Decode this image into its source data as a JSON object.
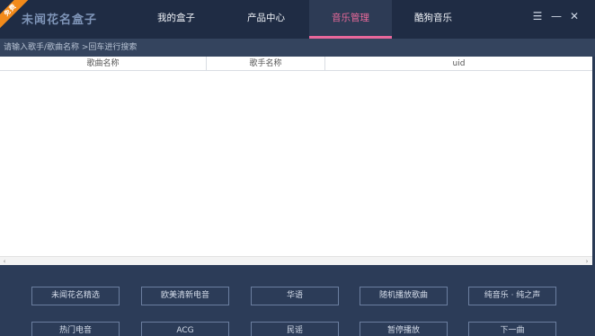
{
  "app": {
    "ribbon": "免费",
    "title": "未闻花名盒子"
  },
  "nav": {
    "tabs": [
      {
        "label": "我的盒子",
        "active": false
      },
      {
        "label": "产品中心",
        "active": false
      },
      {
        "label": "音乐管理",
        "active": true
      },
      {
        "label": "酷狗音乐",
        "active": false
      }
    ]
  },
  "window_controls": {
    "menu": "☰",
    "minimize": "—",
    "close": "✕"
  },
  "search": {
    "placeholder": "请输入歌手/歌曲名称 >回车进行搜索"
  },
  "table": {
    "columns": [
      "歌曲名称",
      "歌手名称",
      "uid"
    ],
    "rows": []
  },
  "scrollbar": {
    "left_arrow": "‹",
    "right_arrow": "›"
  },
  "buttons": {
    "row1": [
      "未闻花名精选",
      "欧美清新电音",
      "华语",
      "随机播放歌曲",
      "纯音乐 · 纯之声"
    ],
    "row2": [
      "热门电音",
      "ACG",
      "民谣",
      "暂停播放",
      "下一曲"
    ]
  },
  "colors": {
    "accent": "#e8679b",
    "titlebar": "#1f2c44",
    "ribbon": "#f28a1a"
  }
}
